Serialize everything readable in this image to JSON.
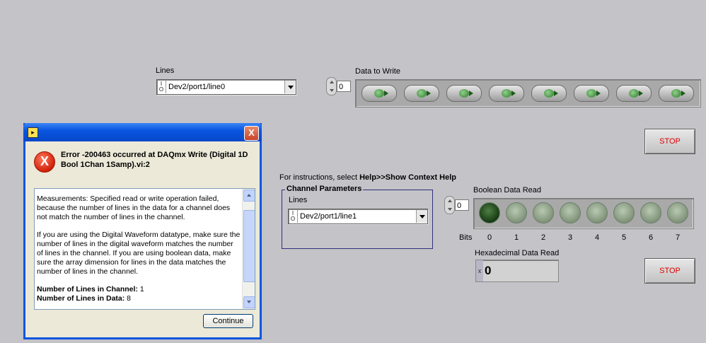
{
  "lines_top": {
    "label": "Lines",
    "value": "Dev2/port1/line0",
    "io_glyph": "I/O"
  },
  "data_to_write": {
    "label": "Data to Write",
    "index": "0",
    "count": 8
  },
  "stop1": {
    "label": "STOP"
  },
  "stop2": {
    "label": "STOP"
  },
  "instructions": {
    "prefix": "For instructions, select ",
    "bold": "Help>>Show Context Help"
  },
  "channel_params": {
    "title": "Channel Parameters",
    "lines_label": "Lines",
    "lines_value": "Dev2/port1/line1",
    "io_glyph": "I/O"
  },
  "boolean_read": {
    "label": "Boolean Data Read",
    "index": "0",
    "bits_label": "Bits",
    "bits": [
      "0",
      "1",
      "2",
      "3",
      "4",
      "5",
      "6",
      "7"
    ],
    "states": [
      true,
      false,
      false,
      false,
      false,
      false,
      false,
      false
    ]
  },
  "hex_read": {
    "label": "Hexadecimal Data Read",
    "prefix": "x",
    "value": "0"
  },
  "dialog": {
    "close_glyph": "X",
    "icon_glyph": "X",
    "heading": "Error -200463 occurred at DAQmx Write (Digital 1D Bool 1Chan 1Samp).vi:2",
    "para1": "Measurements: Specified read or write operation failed, because the number of lines in the data for a channel does not match the number of lines in the channel.",
    "para2": "If you are using the Digital Waveform datatype, make sure the number of lines in the digital waveform matches the number of lines in the channel. If you are using boolean data, make sure the array dimension for lines in the data matches the number of lines in the channel.",
    "k1": "Number of Lines in Channel:",
    "v1": " 1",
    "k2": "Number of Lines in Data:",
    "v2": " 8",
    "continue_label": "Continue"
  },
  "colors": {
    "panel": "#c4c3c8",
    "stop_text": "#e00000",
    "dialog_title": "#0a56e0"
  }
}
